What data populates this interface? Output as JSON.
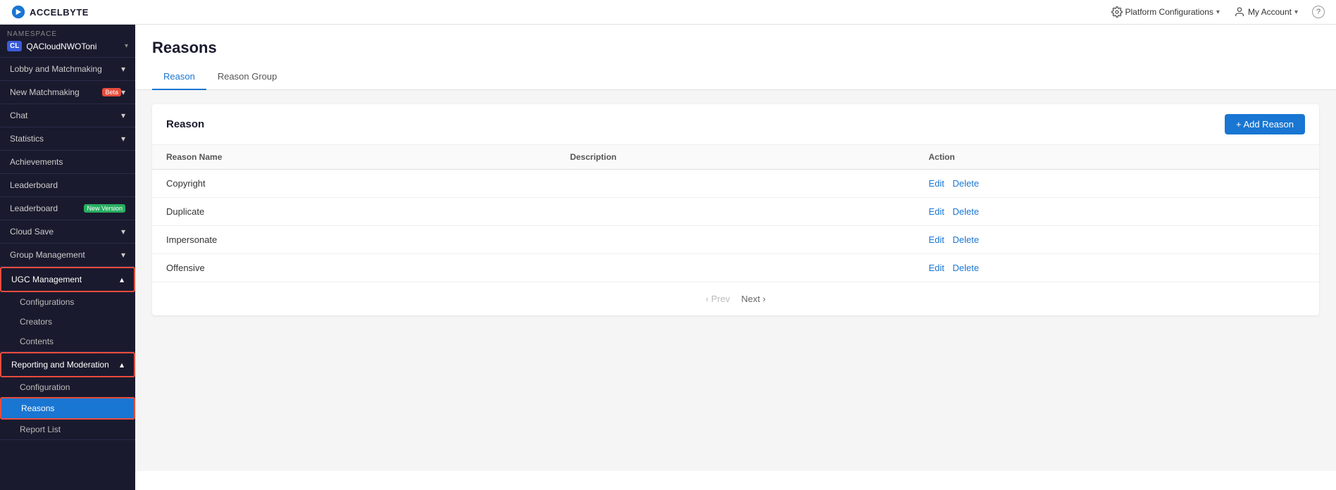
{
  "topbar": {
    "logo_text": "ACCELBYTE",
    "platform_config_label": "Platform Configurations",
    "account_label": "My Account",
    "help_label": "?"
  },
  "sidebar": {
    "namespace_label": "NAMESPACE",
    "namespace_badge": "CL",
    "namespace_name": "QACloudNWOToni",
    "nav_items": [
      {
        "id": "lobby",
        "label": "Lobby and Matchmaking",
        "has_chevron": true,
        "expanded": false
      },
      {
        "id": "new-matchmaking",
        "label": "New Matchmaking",
        "badge": "Beta",
        "has_chevron": true,
        "expanded": false
      },
      {
        "id": "chat",
        "label": "Chat",
        "has_chevron": true,
        "expanded": false
      },
      {
        "id": "statistics",
        "label": "Statistics",
        "has_chevron": true,
        "expanded": false
      },
      {
        "id": "achievements",
        "label": "Achievements",
        "has_chevron": false,
        "expanded": false
      },
      {
        "id": "leaderboard1",
        "label": "Leaderboard",
        "has_chevron": false,
        "expanded": false
      },
      {
        "id": "leaderboard2",
        "label": "Leaderboard",
        "badge": "New Version",
        "has_chevron": false,
        "expanded": false
      },
      {
        "id": "cloud-save",
        "label": "Cloud Save",
        "has_chevron": true,
        "expanded": false
      },
      {
        "id": "group-management",
        "label": "Group Management",
        "has_chevron": true,
        "expanded": false
      },
      {
        "id": "ugc-management",
        "label": "UGC Management",
        "has_chevron": true,
        "expanded": true,
        "active_section": true,
        "sub_items": [
          {
            "id": "ugc-configurations",
            "label": "Configurations"
          },
          {
            "id": "ugc-creators",
            "label": "Creators"
          },
          {
            "id": "ugc-contents",
            "label": "Contents"
          }
        ]
      },
      {
        "id": "reporting-moderation",
        "label": "Reporting and Moderation",
        "has_chevron": true,
        "expanded": true,
        "active_section": true,
        "sub_items": [
          {
            "id": "rm-configuration",
            "label": "Configuration"
          },
          {
            "id": "rm-reasons",
            "label": "Reasons",
            "active": true
          },
          {
            "id": "rm-report-list",
            "label": "Report List"
          }
        ]
      }
    ]
  },
  "page": {
    "title": "Reasons",
    "tabs": [
      {
        "id": "reason",
        "label": "Reason",
        "active": true
      },
      {
        "id": "reason-group",
        "label": "Reason Group",
        "active": false
      }
    ],
    "section_title": "Reason",
    "add_button": "+ Add Reason",
    "table": {
      "columns": [
        {
          "id": "reason-name",
          "label": "Reason Name"
        },
        {
          "id": "description",
          "label": "Description"
        },
        {
          "id": "action",
          "label": "Action"
        }
      ],
      "rows": [
        {
          "name": "Copyright",
          "description": "",
          "edit": "Edit",
          "delete": "Delete"
        },
        {
          "name": "Duplicate",
          "description": "",
          "edit": "Edit",
          "delete": "Delete"
        },
        {
          "name": "Impersonate",
          "description": "",
          "edit": "Edit",
          "delete": "Delete"
        },
        {
          "name": "Offensive",
          "description": "",
          "edit": "Edit",
          "delete": "Delete"
        }
      ]
    },
    "pagination": {
      "prev_label": "‹ Prev",
      "next_label": "Next ›"
    }
  }
}
